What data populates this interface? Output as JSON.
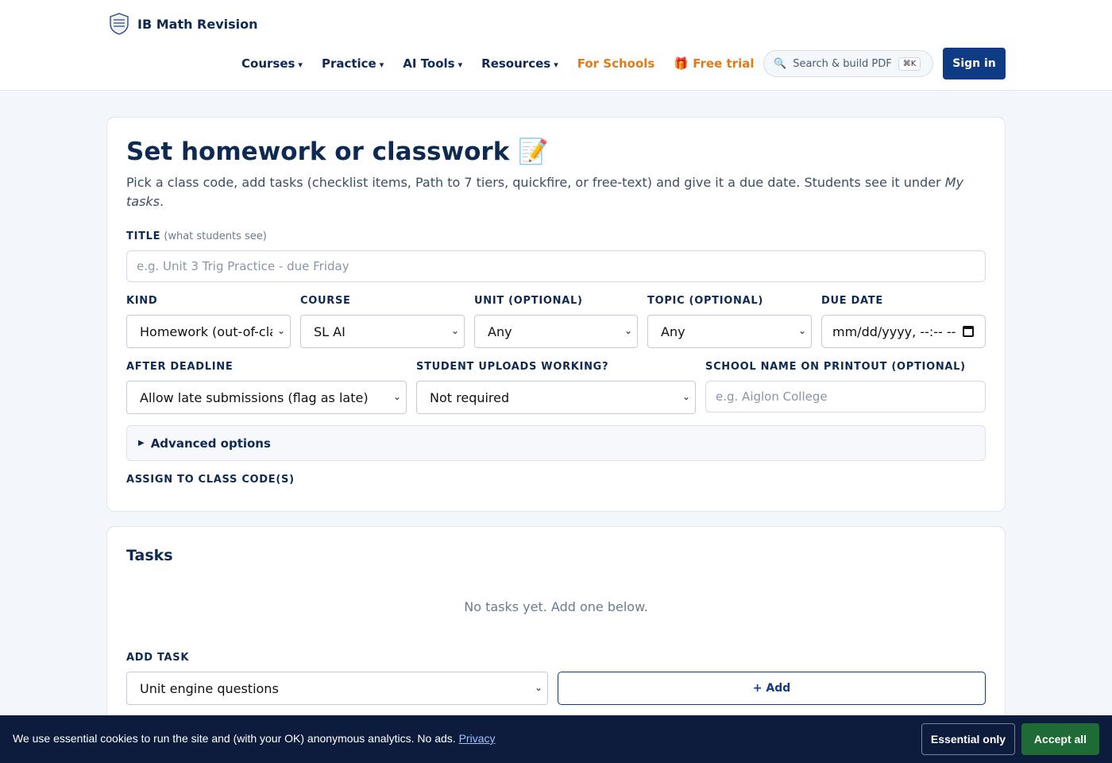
{
  "brand": {
    "name": "IB Math Revision",
    "logo_icon": "shield-crest-icon"
  },
  "nav": {
    "items": [
      {
        "label": "Courses",
        "caret": "▾"
      },
      {
        "label": "Practice",
        "caret": "▾"
      },
      {
        "label": "AI Tools",
        "caret": "▾"
      },
      {
        "label": "Resources",
        "caret": "▾"
      }
    ],
    "for_schools": "For Schools",
    "free_trial": "🎁 Free trial",
    "search_placeholder": "Search & build PDF",
    "search_shortcut": "⌘K",
    "sign_in": "Sign in"
  },
  "form": {
    "heading": "Set homework or classwork 📝",
    "lede_main": "Pick a class code, add tasks (checklist items, Path to 7 tiers, quickfire, or free-text) and give it a due date. Students see it under ",
    "lede_em": "My tasks",
    "lede_end": ".",
    "title_label": "Title",
    "title_hint": "(what students see)",
    "title_placeholder": "e.g. Unit 3 Trig Practice - due Friday",
    "kind_label": "Kind",
    "kind_value": "Homework (out-of-class)",
    "course_label": "Course",
    "course_value": "SL AI",
    "unit_label": "Unit (optional)",
    "unit_value": "Any",
    "topic_label": "Topic (optional)",
    "topic_value": "Any",
    "due_label": "Due date",
    "due_value": "mm/dd/yyyy, --:-- --",
    "after_label": "After deadline",
    "after_value": "Allow late submissions (flag as late)",
    "uploads_label": "Student uploads working?",
    "uploads_value": "Not required",
    "school_label": "School name on printout (optional)",
    "school_placeholder": "e.g. Aiglon College",
    "advanced": "Advanced options",
    "assign_label": "Assign to class code(s)"
  },
  "tasks": {
    "heading": "Tasks",
    "empty": "No tasks yet. Add one below.",
    "add_label": "Add task",
    "add_type": "Unit engine questions",
    "add_button": "+ Add"
  },
  "cookie": {
    "text": "We use essential cookies to run the site and (with your OK) anonymous analytics. No ads. ",
    "privacy": "Privacy",
    "essential": "Essential only",
    "accept": "Accept all"
  },
  "colors": {
    "navy": "#0f2a52",
    "primary_button": "#0f3a84",
    "orange": "#e07b18",
    "accept_green": "#1f6b35",
    "banner": "#0d1b3d"
  }
}
